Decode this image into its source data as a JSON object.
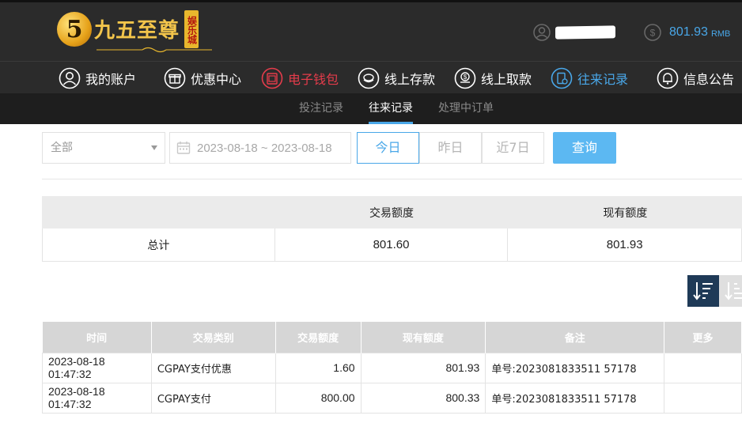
{
  "brand": {
    "logo_main": "九五至尊",
    "logo_badge": "娱乐城",
    "logo_numeral": "5"
  },
  "header": {
    "balance_amount": "801.93",
    "balance_unit": "RMB"
  },
  "nav": {
    "items": [
      {
        "label": "我的账户",
        "icon": "person-icon"
      },
      {
        "label": "优惠中心",
        "icon": "gift-icon"
      },
      {
        "label": "电子钱包",
        "icon": "wallet-icon"
      },
      {
        "label": "线上存款",
        "icon": "deposit-icon"
      },
      {
        "label": "线上取款",
        "icon": "withdraw-icon"
      },
      {
        "label": "往来记录",
        "icon": "records-icon"
      },
      {
        "label": "信息公告",
        "icon": "bell-icon"
      }
    ]
  },
  "subnav": {
    "tabs": [
      "投注记录",
      "往来记录",
      "处理中订单"
    ],
    "active": "往来记录"
  },
  "filter": {
    "type_value": "全部",
    "date_range": "2023-08-18 ~ 2023-08-18",
    "quick": [
      "今日",
      "昨日",
      "近7日"
    ],
    "query_label": "查询"
  },
  "summary": {
    "headers": [
      "",
      "交易额度",
      "现有额度"
    ],
    "row": [
      "总计",
      "801.60",
      "801.93"
    ]
  },
  "records": {
    "headers": [
      "时间",
      "交易类别",
      "交易额度",
      "现有额度",
      "备注",
      "更多"
    ],
    "rows": [
      [
        "2023-08-18 01:47:32",
        "CGPAY支付优惠",
        "1.60",
        "801.93",
        "单号:2023081833511 57178",
        ""
      ],
      [
        "2023-08-18 01:47:32",
        "CGPAY支付",
        "800.00",
        "800.33",
        "单号:2023081833511 57178",
        ""
      ]
    ]
  },
  "colors": {
    "accent": "#49a7e8",
    "active_nav": "#e53c4b",
    "header_bg": "#2b2b2b",
    "query_btn": "#5cb8f2"
  }
}
